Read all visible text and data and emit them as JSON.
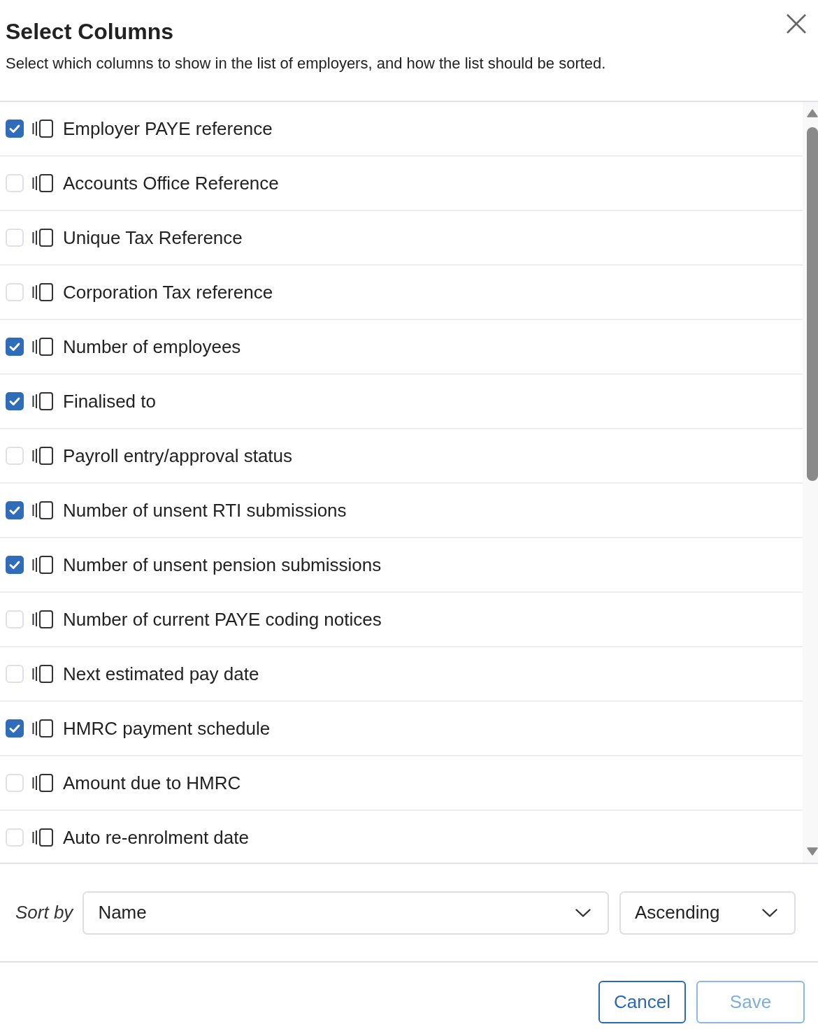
{
  "dialog": {
    "title": "Select Columns",
    "description": "Select which columns to show in the list of employers, and how the list should be sorted."
  },
  "columns": [
    {
      "label": "Employer PAYE reference",
      "checked": true
    },
    {
      "label": "Accounts Office Reference",
      "checked": false
    },
    {
      "label": "Unique Tax Reference",
      "checked": false
    },
    {
      "label": "Corporation Tax reference",
      "checked": false
    },
    {
      "label": "Number of employees",
      "checked": true
    },
    {
      "label": "Finalised to",
      "checked": true
    },
    {
      "label": "Payroll entry/approval status",
      "checked": false
    },
    {
      "label": "Number of unsent RTI submissions",
      "checked": true
    },
    {
      "label": "Number of unsent pension submissions",
      "checked": true
    },
    {
      "label": "Number of current PAYE coding notices",
      "checked": false
    },
    {
      "label": "Next estimated pay date",
      "checked": false
    },
    {
      "label": "HMRC payment schedule",
      "checked": true
    },
    {
      "label": "Amount due to HMRC",
      "checked": false
    },
    {
      "label": "Auto re-enrolment date",
      "checked": false
    }
  ],
  "sort": {
    "label": "Sort by",
    "field": {
      "value": "Name"
    },
    "direction": {
      "value": "Ascending"
    }
  },
  "buttons": [
    {
      "label": "Cancel",
      "disabled": false
    },
    {
      "label": "Save",
      "disabled": true
    }
  ]
}
